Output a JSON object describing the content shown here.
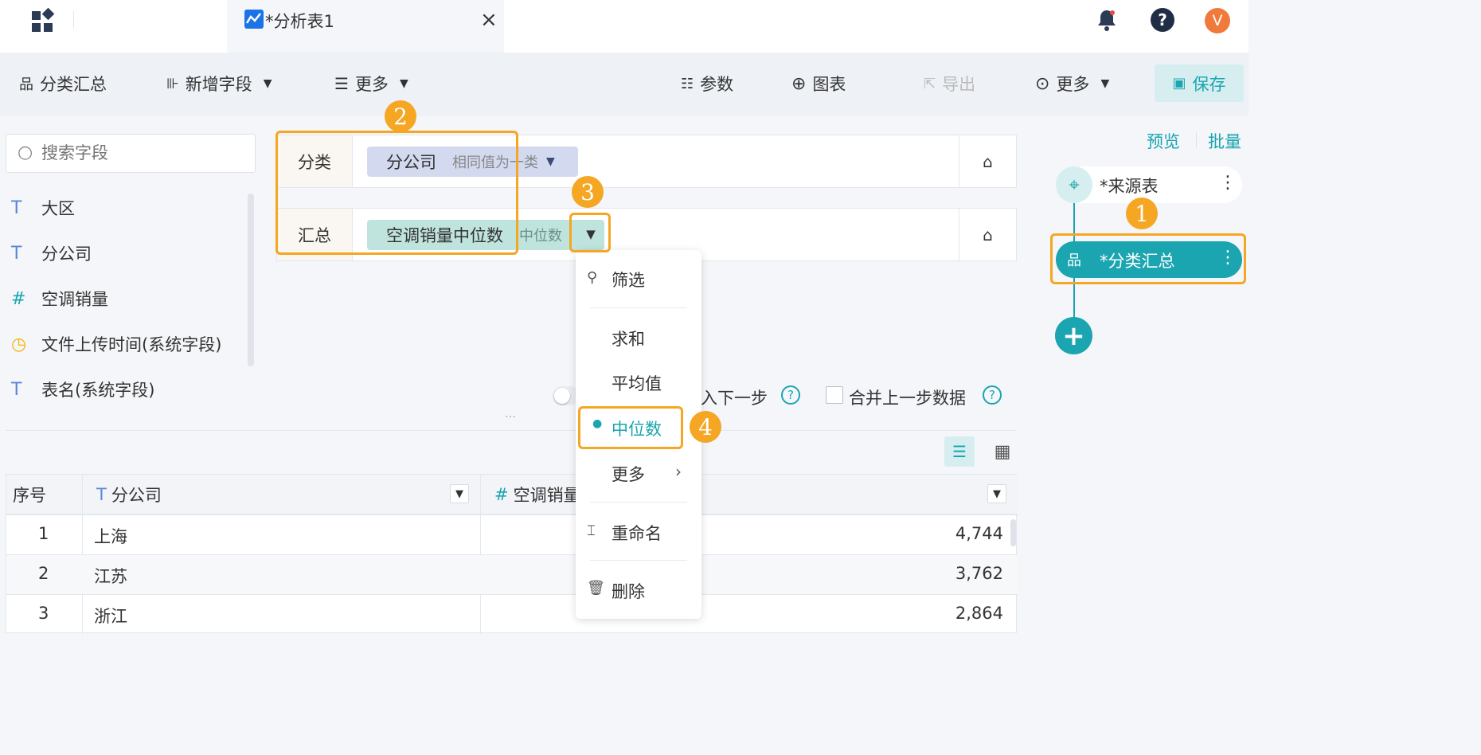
{
  "tab": {
    "title": "*分析表1",
    "close": "×"
  },
  "header": {
    "avatar": "V"
  },
  "toolbar": {
    "group": "分类汇总",
    "add_field": "新增字段",
    "more_left": "更多",
    "params": "参数",
    "chart": "图表",
    "export": "导出",
    "more_right": "更多",
    "save": "保存"
  },
  "search": {
    "placeholder": "搜索字段"
  },
  "fields": [
    {
      "icon": "T",
      "label": "大区"
    },
    {
      "icon": "T",
      "label": "分公司"
    },
    {
      "icon": "#",
      "label": "空调销量"
    },
    {
      "icon": "◷",
      "label": "文件上传时间(系统字段)"
    },
    {
      "icon": "T",
      "label": "表名(系统字段)"
    }
  ],
  "config": {
    "classify_label": "分类",
    "classify_field": "分公司",
    "classify_mode": "相同值为一类",
    "summary_label": "汇总",
    "summary_field": "空调销量中位数",
    "summary_mode": "中位数"
  },
  "menu": {
    "filter": "筛选",
    "sum": "求和",
    "avg": "平均值",
    "median": "中位数",
    "more": "更多",
    "rename": "重命名",
    "delete": "删除"
  },
  "options": {
    "next_step": "入下一步",
    "merge": "合并上一步数据"
  },
  "flow": {
    "preview": "预览",
    "batch": "批量",
    "source": "*来源表",
    "summary": "*分类汇总"
  },
  "badges": [
    "1",
    "2",
    "3",
    "4"
  ],
  "table": {
    "headers": [
      "序号",
      "分公司",
      "空调销量"
    ],
    "rows": [
      {
        "idx": "1",
        "name": "上海",
        "value": "4,744"
      },
      {
        "idx": "2",
        "name": "江苏",
        "value": "3,762"
      },
      {
        "idx": "3",
        "name": "浙江",
        "value": "2,864"
      }
    ]
  },
  "colors": {
    "accent": "#1aa5b0",
    "badge": "#f5a623",
    "avatar": "#f07a3b"
  }
}
